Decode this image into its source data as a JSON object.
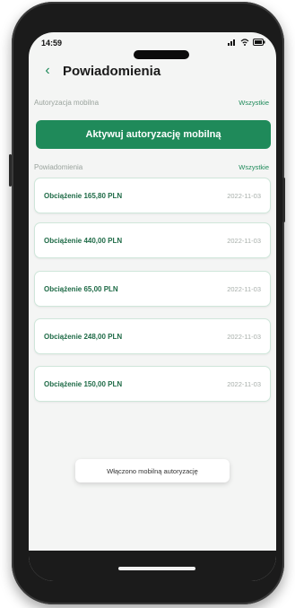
{
  "status_bar": {
    "time": "14:59",
    "signal_icon": "signal-icon",
    "wifi_icon": "wifi-icon",
    "battery_icon": "battery-icon"
  },
  "header": {
    "back_icon": "chevron-left-icon",
    "title": "Powiadomienia"
  },
  "mobile_auth": {
    "label": "Autoryzacja mobilna",
    "link": "Wszystkie",
    "button_label": "Aktywuj autoryzację mobilną"
  },
  "notifications": {
    "label": "Powiadomienia",
    "link": "Wszystkie",
    "items": [
      {
        "title": "Obciążenie 165,80 PLN",
        "date": "2022-11-03"
      },
      {
        "title": "Obciążenie 440,00 PLN",
        "date": "2022-11-03"
      },
      {
        "title": "Obciążenie 65,00 PLN",
        "date": "2022-11-03"
      },
      {
        "title": "Obciążenie 248,00 PLN",
        "date": "2022-11-03"
      },
      {
        "title": "Obciążenie 150,00 PLN",
        "date": "2022-11-03"
      }
    ]
  },
  "toast": {
    "text": "Włączono mobilną autoryzację"
  },
  "colors": {
    "accent": "#1f8a5a",
    "background": "#f4f5f4"
  }
}
